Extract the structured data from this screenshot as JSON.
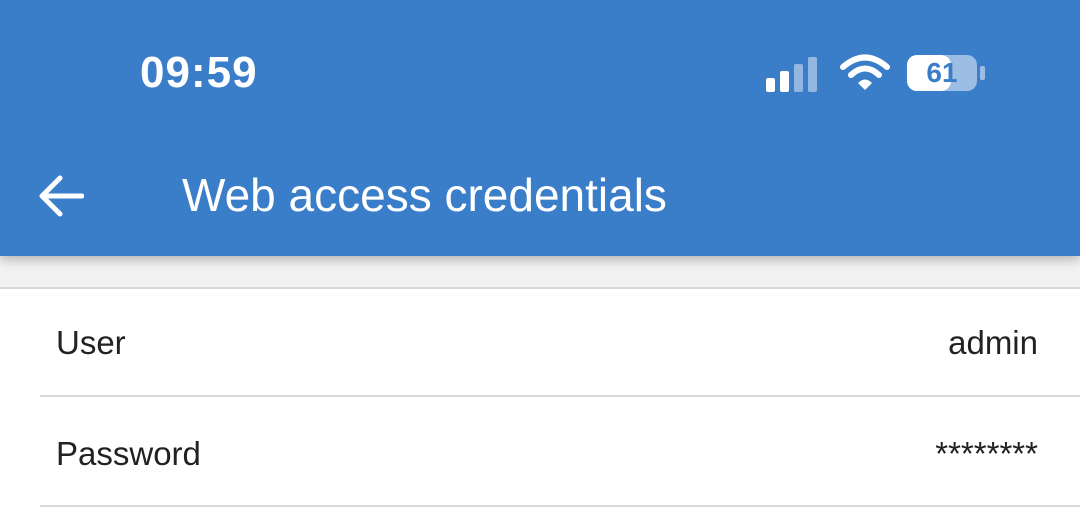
{
  "status_bar": {
    "time": "09:59",
    "battery_level": "61",
    "icons": [
      "signal-icon",
      "wifi-icon",
      "battery-icon"
    ]
  },
  "app_bar": {
    "title": "Web access credentials",
    "back_icon": "arrow-left-icon"
  },
  "fields": [
    {
      "label": "User",
      "value": "admin"
    },
    {
      "label": "Password",
      "value": "********"
    }
  ],
  "colors": {
    "app_bar": "#3a7dc9",
    "background": "#f2f2f2",
    "surface": "#ffffff",
    "divider": "#d9d9d9",
    "text": "#222222"
  }
}
